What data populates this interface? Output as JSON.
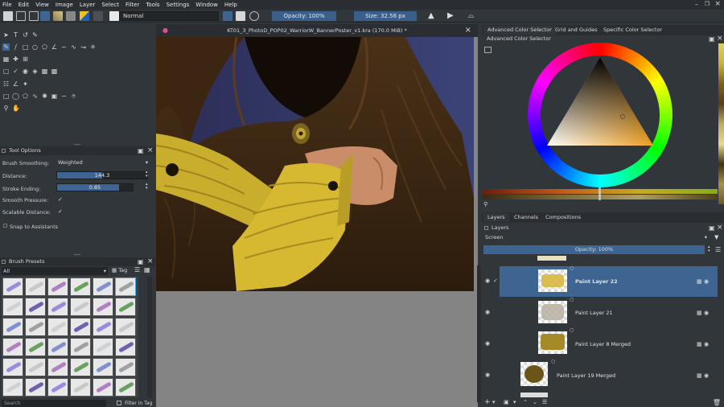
{
  "menu": [
    "File",
    "Edit",
    "View",
    "Image",
    "Layer",
    "Select",
    "Filter",
    "Tools",
    "Settings",
    "Window",
    "Help"
  ],
  "toolbar": {
    "blend_mode": "Normal",
    "opacity_label": "Opacity: 100%",
    "size_label": "Size: 32.56 px"
  },
  "tool_options": {
    "title": "Tool Options",
    "brush_smoothing_label": "Brush Smoothing:",
    "brush_smoothing_value": "Weighted",
    "distance_label": "Distance:",
    "distance_value": "144.3",
    "distance_fraction": 0.5,
    "stroke_ending_label": "Stroke Ending:",
    "stroke_ending_value": "0.85",
    "stroke_ending_fraction": 0.82,
    "smooth_pressure_label": "Smooth Pressure:",
    "scalable_distance_label": "Scalable Distance:",
    "snap_label": "Snap to Assistants"
  },
  "brush_presets": {
    "title": "Brush Presets",
    "filter_value": "All",
    "tag_label": "Tag",
    "search_placeholder": "Search",
    "filter_in_tag": "Filter in Tag"
  },
  "document": {
    "title": "KT01_3_PhotoD_POP02_WarriorW_BannerPoster_v1.kra (170.0 MiB) *"
  },
  "color_panel": {
    "tabs": [
      "Advanced Color Selector",
      "Grid and Guides",
      "Specific Color Selector"
    ],
    "subtitle": "Advanced Color Selector"
  },
  "layers_panel": {
    "tabs": [
      "Layers",
      "Channels",
      "Compositions"
    ],
    "title": "Layers",
    "blend_mode": "Screen",
    "opacity_label": "Opacity:  100%",
    "layers": [
      {
        "name": "Paint Layer 22",
        "selected": true
      },
      {
        "name": "Paint Layer 21",
        "selected": false
      },
      {
        "name": "Paint Layer 8 Merged",
        "selected": false
      },
      {
        "name": "Paint Layer 19 Merged",
        "selected": false
      }
    ]
  },
  "colors": {
    "accent": "#3e6591",
    "bg": "#31363b",
    "canvas_bg": "#848484"
  }
}
